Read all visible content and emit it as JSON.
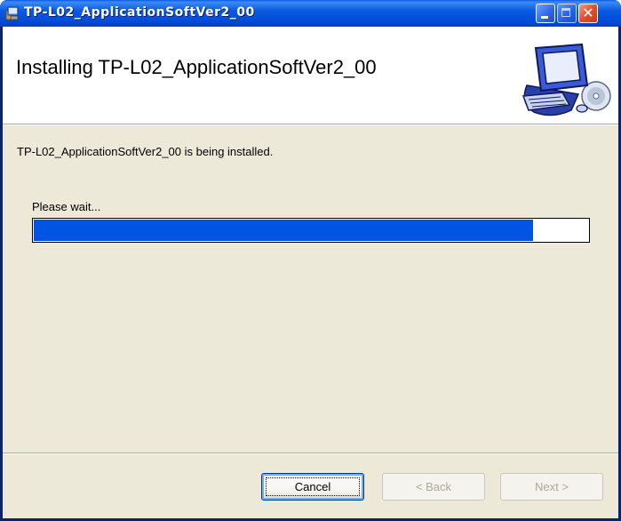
{
  "window": {
    "title": "TP-L02_ApplicationSoftVer2_00",
    "icons": {
      "app": "installer-icon",
      "minimize": "minimize-icon",
      "maximize": "maximize-icon",
      "close": "close-icon",
      "banner_art": "computer-with-cd-icon"
    }
  },
  "banner": {
    "title": "Installing TP-L02_ApplicationSoftVer2_00"
  },
  "body": {
    "status_text": "TP-L02_ApplicationSoftVer2_00 is being installed.",
    "wait_label": "Please wait...",
    "progress_fraction": 0.9
  },
  "buttons": {
    "cancel": "Cancel",
    "back": "< Back",
    "next": "Next >"
  },
  "colors": {
    "titlebar": "#0054e3",
    "progress_fill": "#0054e3",
    "dialog_bg": "#ece9d8"
  }
}
